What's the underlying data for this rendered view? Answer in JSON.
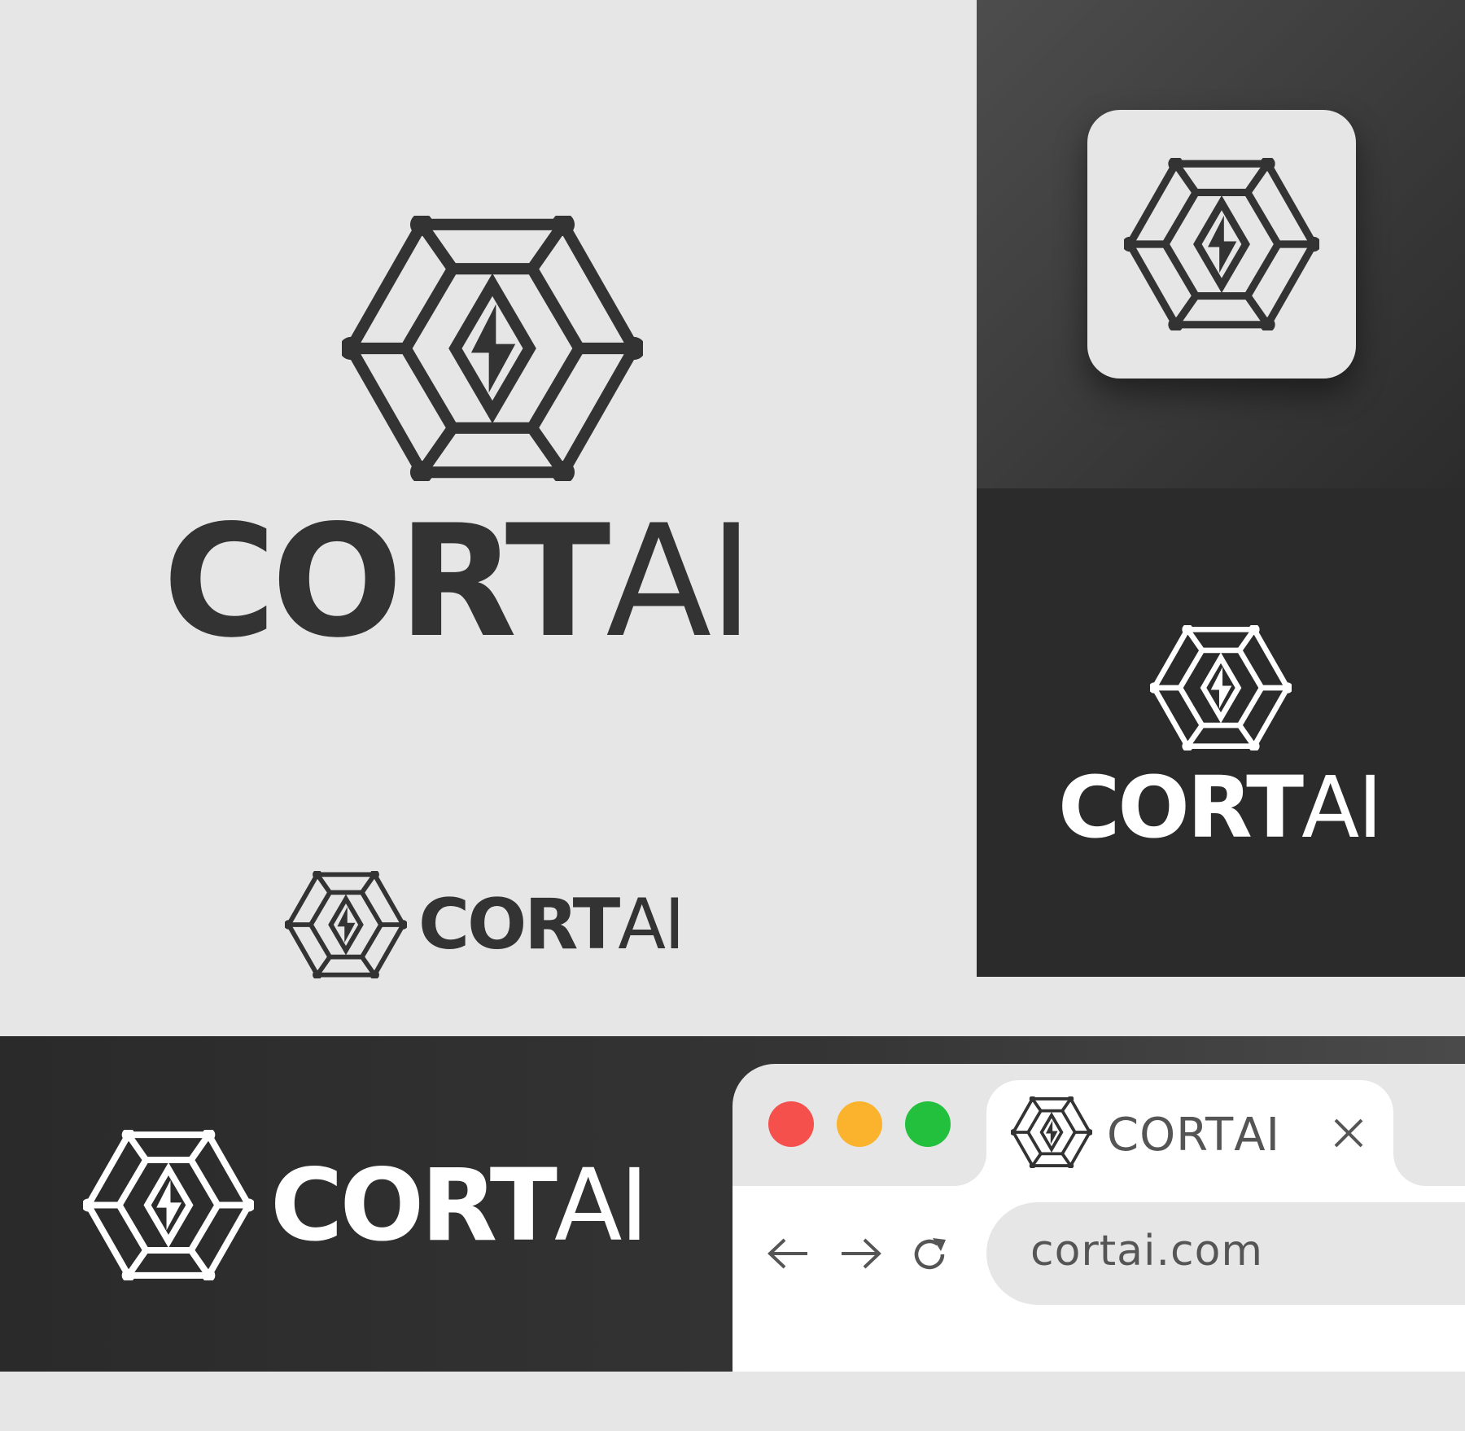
{
  "brand": {
    "bold_part": "CORT",
    "thin_part": "AI"
  },
  "browser": {
    "tab_title_bold": "CORT",
    "tab_title_thin": "AI",
    "url": "cortai.com",
    "traffic_lights": [
      "#f5504c",
      "#fbb32e",
      "#22c03c"
    ]
  },
  "colors": {
    "background": "#e6e6e6",
    "ink": "#333333",
    "dark_panel": "#2b2b2b",
    "white": "#ffffff"
  },
  "icons": [
    "hexagon-logo-icon",
    "close-icon",
    "back-arrow-icon",
    "forward-arrow-icon",
    "reload-icon"
  ]
}
